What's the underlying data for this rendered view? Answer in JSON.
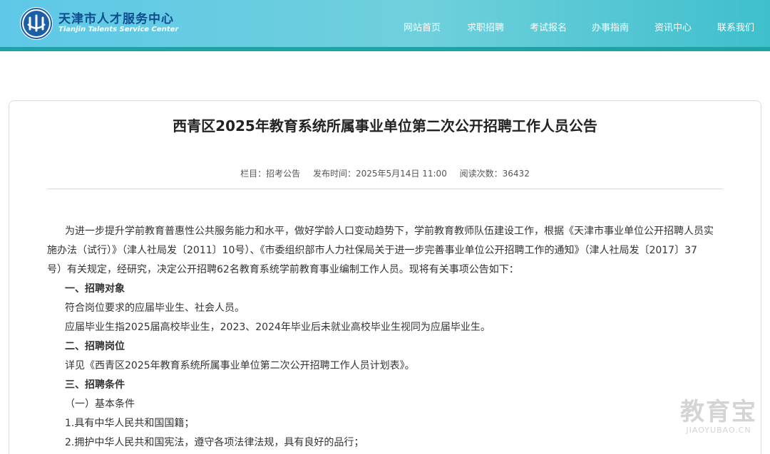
{
  "site": {
    "name_cn": "天津市人才服务中心",
    "name_en": "Tianjin Talents Service Center",
    "logo_icon": "tjrc-logo-icon"
  },
  "nav": {
    "items": [
      {
        "label": "网站首页"
      },
      {
        "label": "求职招聘"
      },
      {
        "label": "考试报名"
      },
      {
        "label": "办事指南"
      },
      {
        "label": "资讯中心"
      },
      {
        "label": "联系我们"
      }
    ]
  },
  "article": {
    "title": "西青区2025年教育系统所属事业单位第二次公开招聘工作人员公告",
    "meta": {
      "column": "栏目：招考公告",
      "published": "发布时间：2025年5月14日 11:00",
      "views": "阅读次数：36432"
    },
    "intro_1": "为进一步提升学前教育普惠性公共服务能力和水平，做好学龄人口变动趋势下，学前教育教师队伍建设工作，根据《天津市事业单位公开招聘人员实",
    "intro_2": "施办法（试行）》（津人社局发〔2011〕10号）、《市委组织部市人力社保局关于进一步完善事业单位公开招聘工作的通知》（津人社局发〔2017〕37",
    "intro_3": "号）有关规定，经研究，决定公开招聘62名教育系统学前教育事业编制工作人员。现将有关事项公告如下：",
    "section_1": "一、招聘对象",
    "s1_line_1": "符合岗位要求的应届毕业生、社会人员。",
    "s1_line_2": "应届毕业生指2025届高校毕业生，2023、2024年毕业后未就业高校毕业生视同为应届毕业生。",
    "section_2": "二、招聘岗位",
    "s2_line_1": "详见《西青区2025年教育系统所属事业单位第二次公开招聘工作人员计划表》。",
    "section_3": "三、招聘条件",
    "s3_sub_1": "（一）基本条件",
    "s3_item_1": "1.具有中华人民共和国国籍；",
    "s3_item_2": "2.拥护中华人民共和国宪法，遵守各项法律法规，具有良好的品行；"
  },
  "watermark": {
    "cn": "教育宝",
    "en": "JIAOYUBAO.CN"
  },
  "colors": {
    "header_start": "#5fc8e8",
    "header_end": "#3fbfcc",
    "header_bar": "#1fa3a7",
    "brand_text": "#0f4d8c"
  }
}
